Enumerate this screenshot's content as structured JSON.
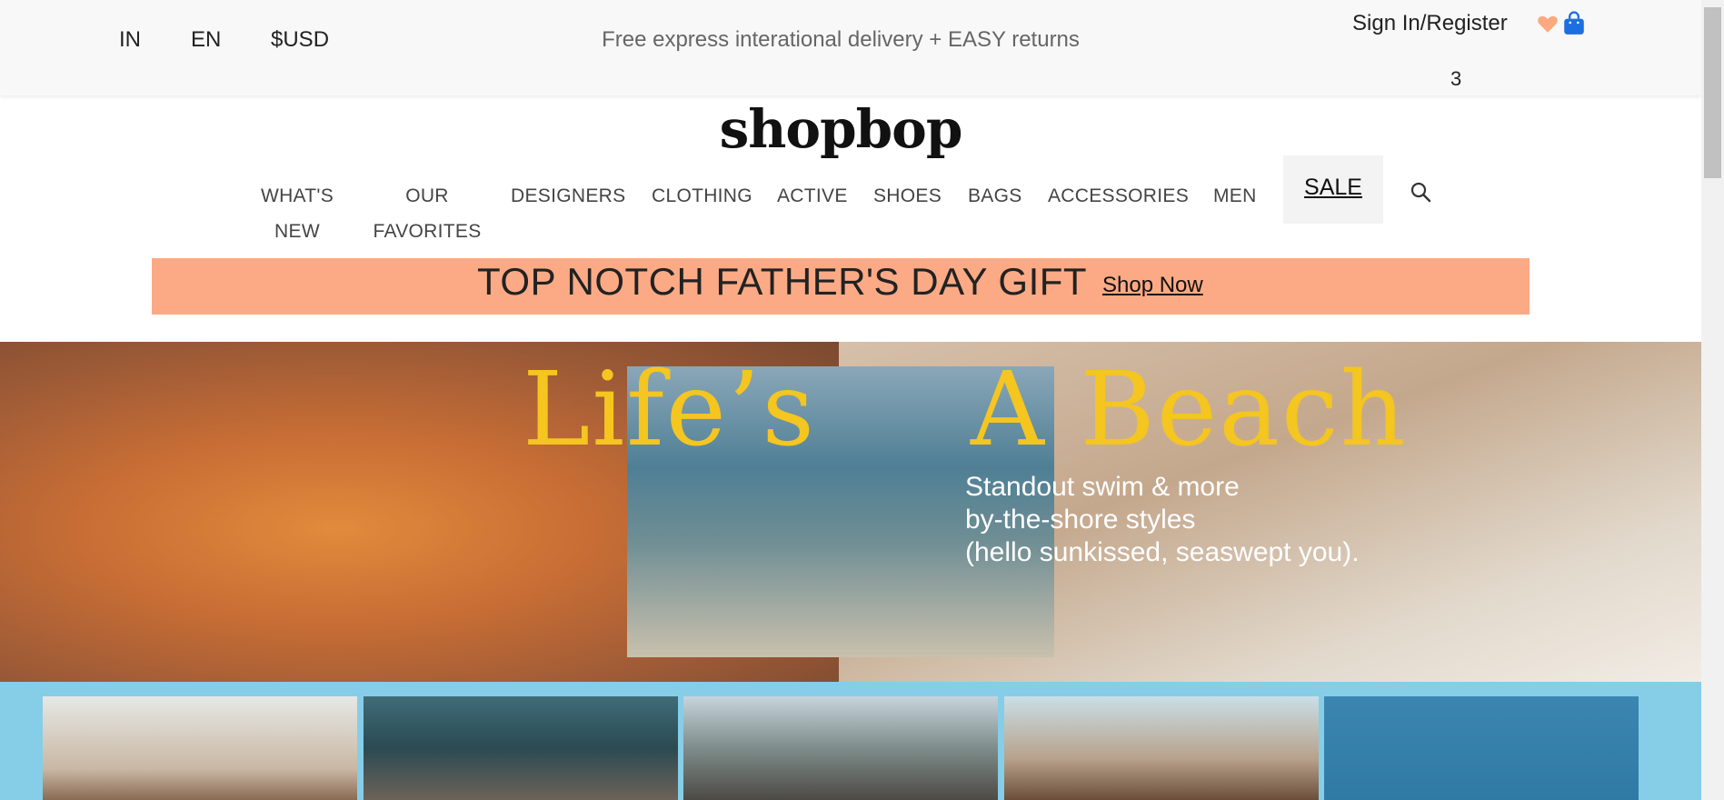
{
  "topbar": {
    "country": "IN",
    "language": "EN",
    "currency": "$USD",
    "promo": "Free express interational delivery + EASY returns",
    "signin": "Sign In/Register",
    "bag_count": "3",
    "icons": [
      "heart-icon",
      "bag-icon"
    ]
  },
  "logo": "shopbop",
  "nav": {
    "items": [
      {
        "line1": "WHAT'S",
        "line2": "NEW"
      },
      {
        "line1": "OUR",
        "line2": "FAVORITES"
      },
      {
        "line1": "DESIGNERS"
      },
      {
        "line1": "CLOTHING"
      },
      {
        "line1": "ACTIVE"
      },
      {
        "line1": "SHOES"
      },
      {
        "line1": "BAGS"
      },
      {
        "line1": "ACCESSORIES"
      },
      {
        "line1": "MEN"
      }
    ],
    "sale": "SALE"
  },
  "banner": {
    "text": "TOP NOTCH FATHER'S DAY GIFT",
    "link": "Shop Now",
    "color": "#fcaa85"
  },
  "hero": {
    "title_part1": "Life’s",
    "title_part2": "A Beach",
    "subtitle_lines": [
      "Standout swim & more",
      "by-the-shore styles",
      "(hello sunkissed, seaswept you)."
    ],
    "title_color": "#f5c520"
  },
  "strip_color": "#86cde8"
}
